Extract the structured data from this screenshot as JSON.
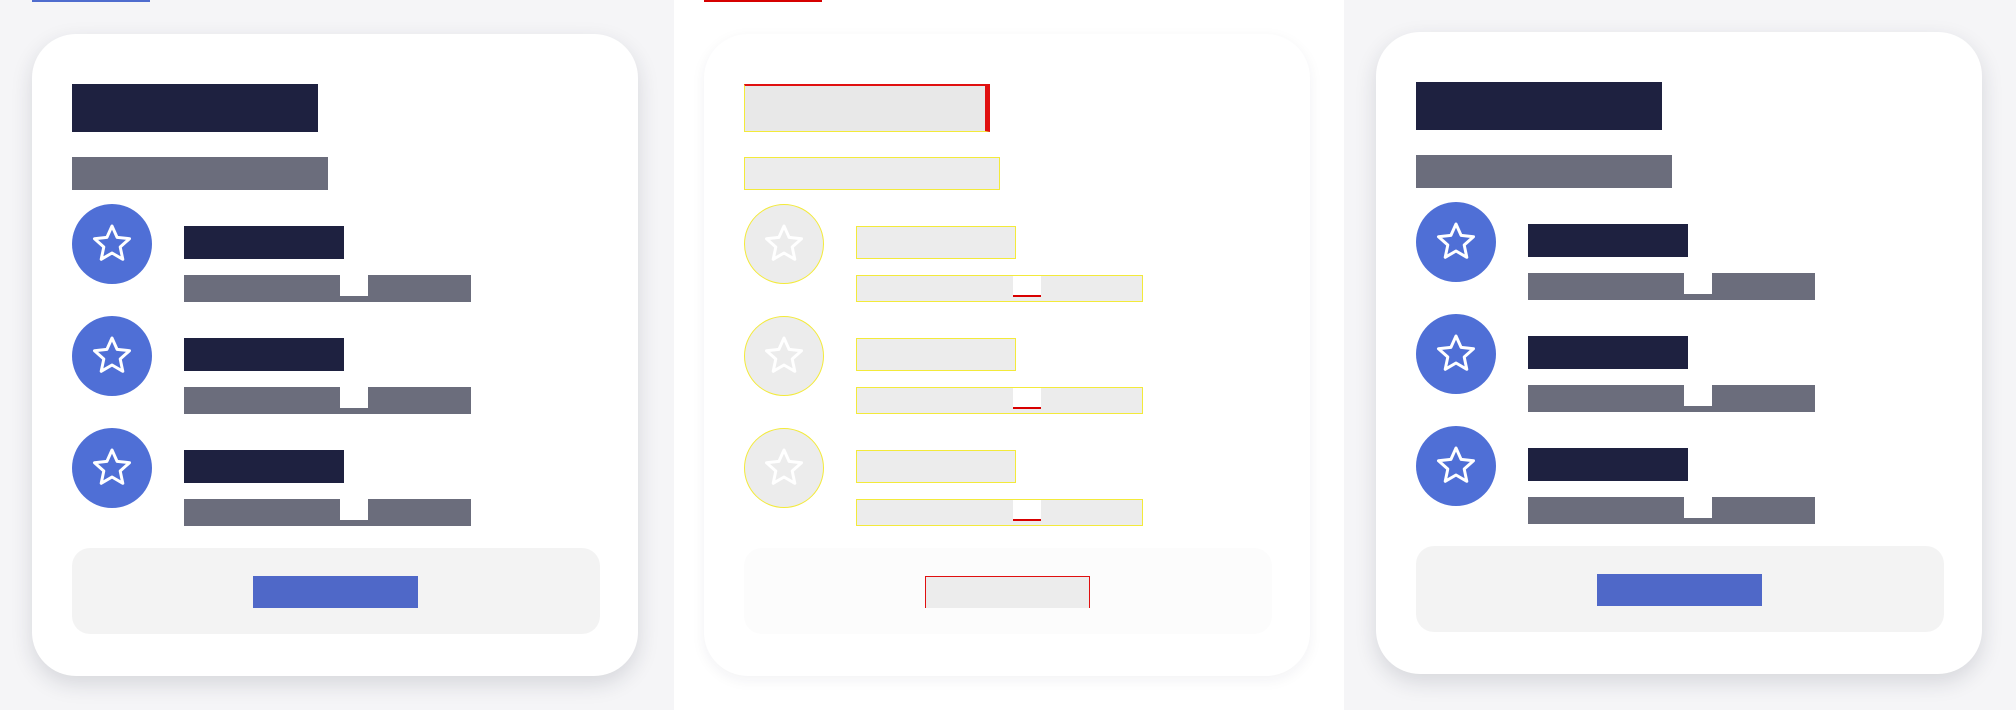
{
  "screenshot": {
    "variants": [
      {
        "id": "filled-card-left",
        "state": "rendered",
        "card": {
          "title": "",
          "subtitle": "",
          "features": [
            {
              "icon": "star-icon",
              "title": "",
              "description": ""
            },
            {
              "icon": "star-icon",
              "title": "",
              "description": ""
            },
            {
              "icon": "star-icon",
              "title": "",
              "description": ""
            }
          ],
          "cta_label": ""
        }
      },
      {
        "id": "wireframe-card-middle",
        "state": "skeleton",
        "card": {
          "title": "",
          "subtitle": "",
          "features": [
            {
              "icon": "star-icon",
              "title": "",
              "description": ""
            },
            {
              "icon": "star-icon",
              "title": "",
              "description": ""
            },
            {
              "icon": "star-icon",
              "title": "",
              "description": ""
            }
          ],
          "cta_label": ""
        }
      },
      {
        "id": "filled-card-right",
        "state": "rendered",
        "card": {
          "title": "",
          "subtitle": "",
          "features": [
            {
              "icon": "star-icon",
              "title": "",
              "description": ""
            },
            {
              "icon": "star-icon",
              "title": "",
              "description": ""
            },
            {
              "icon": "star-icon",
              "title": "",
              "description": ""
            }
          ],
          "cta_label": ""
        }
      }
    ]
  },
  "colors": {
    "page_background": "#f1f1f4",
    "card_background": "#ffffff",
    "heading_block": "#1e2140",
    "body_block": "#6b6d7c",
    "icon_accent": "#4f6fd6",
    "cta_background": "#4f68c8",
    "cta_well": "#f3f3f3",
    "wireframe_fill": "#ececec",
    "wireframe_yellow": "#f3ea3a",
    "wireframe_red": "#e01010"
  }
}
